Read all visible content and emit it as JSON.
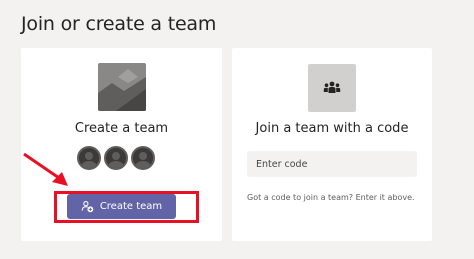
{
  "page": {
    "title": "Join or create a team"
  },
  "create_card": {
    "title": "Create a team",
    "button_label": "Create team"
  },
  "join_card": {
    "title": "Join a team with a code",
    "code_input": {
      "placeholder": "Enter code",
      "value": ""
    },
    "hint": "Got a code to join a team? Enter it above."
  },
  "colors": {
    "accent": "#6264a7",
    "highlight": "#e81123",
    "background": "#f3f2f1"
  }
}
